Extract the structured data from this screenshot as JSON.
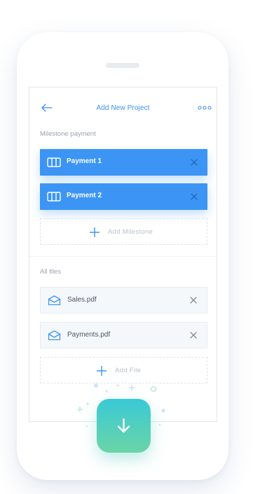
{
  "header": {
    "back_icon": "arrow-left-icon",
    "title": "Add New Project",
    "more_icon": "more-dots-icon"
  },
  "milestones": {
    "section_label": "Milestone payment",
    "items": [
      {
        "label": "Payment 1",
        "icon": "columns-icon"
      },
      {
        "label": "Payment 2",
        "icon": "columns-icon"
      }
    ],
    "add_label": "Add Milestone"
  },
  "files": {
    "section_label": "All files",
    "items": [
      {
        "label": "Sales.pdf",
        "icon": "envelope-icon"
      },
      {
        "label": "Payments.pdf",
        "icon": "envelope-icon"
      }
    ],
    "add_label": "Add File"
  },
  "fab": {
    "icon": "arrow-down-icon"
  },
  "colors": {
    "accent_blue": "#3c95f4",
    "fab_gradient_top": "#39c9d6",
    "fab_gradient_bottom": "#6ad5a6"
  }
}
